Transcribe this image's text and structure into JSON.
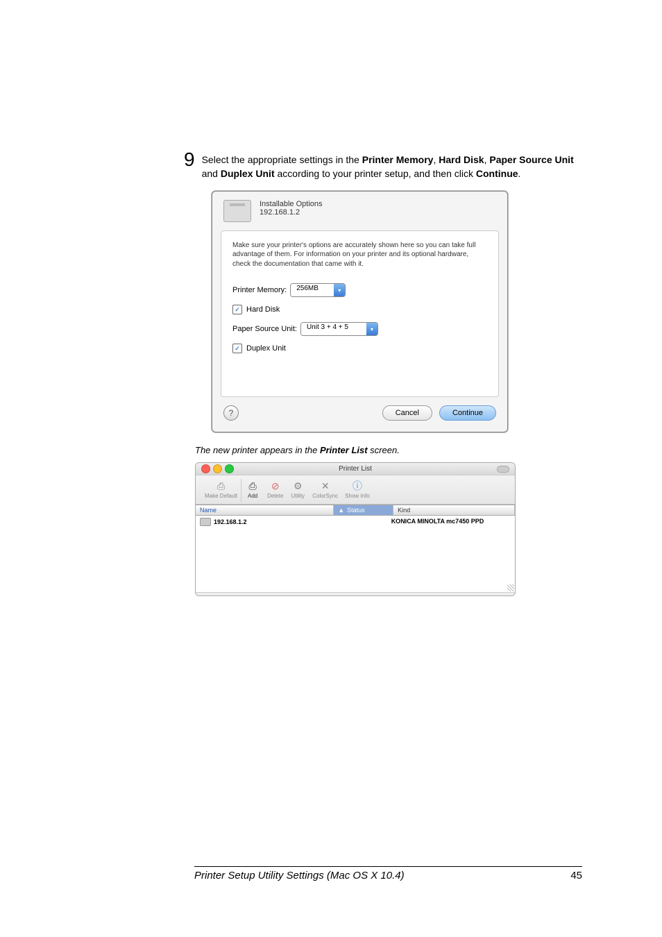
{
  "step": {
    "number": "9",
    "text_a": "Select the appropriate settings in the ",
    "b1": "Printer Memory",
    "sep1": ", ",
    "b2": "Hard Disk",
    "sep2": ", ",
    "b3": "Paper Source Unit",
    "mid": " and ",
    "b4": "Duplex Unit",
    "text_b": " according to your printer setup, and then click ",
    "b5": "Continue",
    "dot": "."
  },
  "dialog": {
    "title": "Installable Options",
    "address": "192.168.1.2",
    "info": "Make sure your printer's options are accurately shown here so you can take full advantage of them. For information on your printer and its optional hardware, check the documentation that came with it.",
    "memory_label": "Printer Memory:",
    "memory_value": "256MB",
    "hd_label": "Hard Disk",
    "psu_label": "Paper Source Unit:",
    "psu_value": "Unit 3 + 4 + 5",
    "duplex_label": "Duplex Unit",
    "help": "?",
    "cancel": "Cancel",
    "continue": "Continue"
  },
  "caption": {
    "a": "The new printer appears in the ",
    "b": "Printer List",
    "c": " screen."
  },
  "listwin": {
    "title": "Printer List",
    "toolbar": {
      "make_default": "Make Default",
      "add": "Add",
      "delete": "Delete",
      "utility": "Utility",
      "colorsync": "ColorSync",
      "showinfo": "Show Info"
    },
    "cols": {
      "name": "Name",
      "status": "Status",
      "kind": "Kind",
      "arrow": "▲"
    },
    "row": {
      "name": "192.168.1.2",
      "kind": "KONICA MINOLTA mc7450 PPD"
    }
  },
  "footer": {
    "title": "Printer Setup Utility Settings (Mac OS X 10.4)",
    "page": "45"
  }
}
